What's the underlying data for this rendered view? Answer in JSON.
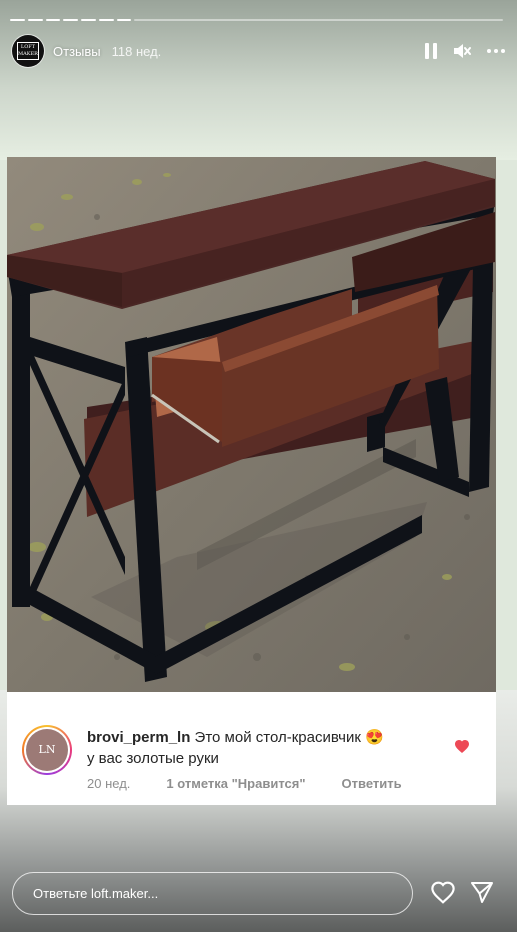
{
  "story": {
    "account_name": "Отзывы",
    "time_ago": "118 нед.",
    "avatar_logo_text": "LOFT MAKER",
    "icons": [
      "pause-icon",
      "mute-icon",
      "more-icon"
    ]
  },
  "comment": {
    "username": "brovi_perm_ln",
    "text_line1": "Это мой стол-красивчик 😍",
    "text_line2": "у вас золотые руки",
    "avatar_text": "LN",
    "time_ago": "20 нед.",
    "likes": "1 отметка \"Нравится\"",
    "reply_label": "Ответить",
    "like_color": "#ed4956"
  },
  "footer": {
    "reply_placeholder": "Ответьте loft.maker...",
    "icons": [
      "heart-icon",
      "send-icon"
    ]
  }
}
